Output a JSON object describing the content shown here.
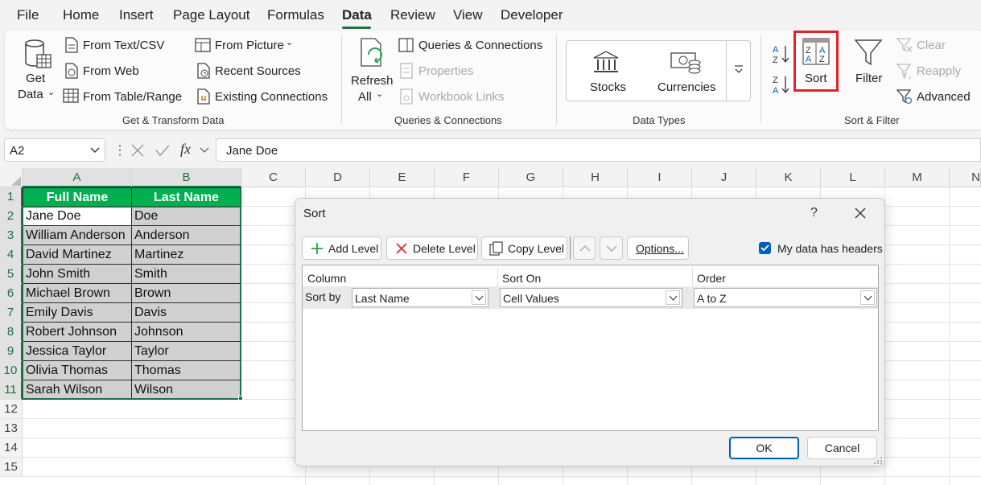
{
  "menu": {
    "items": [
      "File",
      "Home",
      "Insert",
      "Page Layout",
      "Formulas",
      "Data",
      "Review",
      "View",
      "Developer"
    ],
    "active": "Data"
  },
  "ribbon": {
    "get_data_1": "Get",
    "get_data_2": "Data",
    "from_text_csv": "From Text/CSV",
    "from_web": "From Web",
    "from_table_range": "From Table/Range",
    "from_picture": "From Picture",
    "recent_sources": "Recent Sources",
    "existing_connections": "Existing Connections",
    "group_get_transform": "Get & Transform Data",
    "refresh_1": "Refresh",
    "refresh_2": "All",
    "queries_connections": "Queries & Connections",
    "properties": "Properties",
    "workbook_links": "Workbook Links",
    "group_queries": "Queries & Connections",
    "stocks": "Stocks",
    "currencies": "Currencies",
    "group_data_types": "Data Types",
    "sort": "Sort",
    "filter": "Filter",
    "clear": "Clear",
    "reapply": "Reapply",
    "advanced": "Advanced",
    "group_sort_filter": "Sort & Filter",
    "highlight_color": "#e3212a"
  },
  "formula_bar": {
    "name_box": "A2",
    "fx": "fx",
    "content": "Jane Doe"
  },
  "sheet": {
    "columns": [
      "A",
      "B",
      "C",
      "D",
      "E",
      "F",
      "G",
      "H",
      "I",
      "J",
      "K",
      "L",
      "M",
      "N"
    ],
    "rows": [
      "1",
      "2",
      "3",
      "4",
      "5",
      "6",
      "7",
      "8",
      "9",
      "10",
      "11",
      "12",
      "13",
      "14",
      "15"
    ],
    "headers": [
      "Full Name",
      "Last Name"
    ],
    "data": [
      [
        "Jane Doe",
        "Doe"
      ],
      [
        "William Anderson",
        "Anderson"
      ],
      [
        "David Martinez",
        "Martinez"
      ],
      [
        "John Smith",
        "Smith"
      ],
      [
        "Michael Brown",
        "Brown"
      ],
      [
        "Emily Davis",
        "Davis"
      ],
      [
        "Robert Johnson",
        "Johnson"
      ],
      [
        "Jessica Taylor",
        "Taylor"
      ],
      [
        "Olivia Thomas",
        "Thomas"
      ],
      [
        "Sarah Wilson",
        "Wilson"
      ]
    ],
    "header_color": "#00b050",
    "selection_color": "#1e7145"
  },
  "dialog": {
    "title": "Sort",
    "help": "?",
    "add_level": "Add Level",
    "delete_level": "Delete Level",
    "copy_level": "Copy Level",
    "options": "Options...",
    "my_data_has_headers": "My data has headers",
    "col_column": "Column",
    "col_sort_on": "Sort On",
    "col_order": "Order",
    "sort_by": "Sort by",
    "column_value": "Last Name",
    "sort_on_value": "Cell Values",
    "order_value": "A to Z",
    "ok": "OK",
    "cancel": "Cancel"
  }
}
